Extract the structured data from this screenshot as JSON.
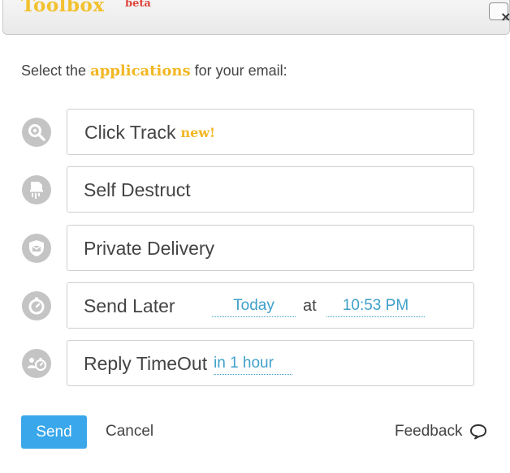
{
  "header": {
    "brand": "Toolbox",
    "badge": "beta",
    "close_symbol": "×"
  },
  "prompt": {
    "before": "Select the ",
    "highlight": "applications",
    "after": " for your email:"
  },
  "apps": [
    {
      "icon": "magnifier-icon",
      "label": "Click Track",
      "tag": "new!"
    },
    {
      "icon": "shredder-icon",
      "label": "Self Destruct"
    },
    {
      "icon": "shield-envelope-icon",
      "label": "Private Delivery"
    },
    {
      "icon": "stopwatch-icon",
      "label": "Send Later",
      "day": "Today",
      "at": "at",
      "time": "10:53 PM"
    },
    {
      "icon": "reply-timer-icon",
      "label": "Reply TimeOut",
      "delay": "in 1 hour"
    }
  ],
  "footer": {
    "send": "Send",
    "cancel": "Cancel",
    "feedback": "Feedback"
  },
  "colors": {
    "accent_yellow": "#f2b723",
    "beta_red": "#e0463d",
    "link_blue": "#3ea0c9",
    "send_blue": "#39a7ea",
    "icon_gray": "#c4c4c4"
  }
}
